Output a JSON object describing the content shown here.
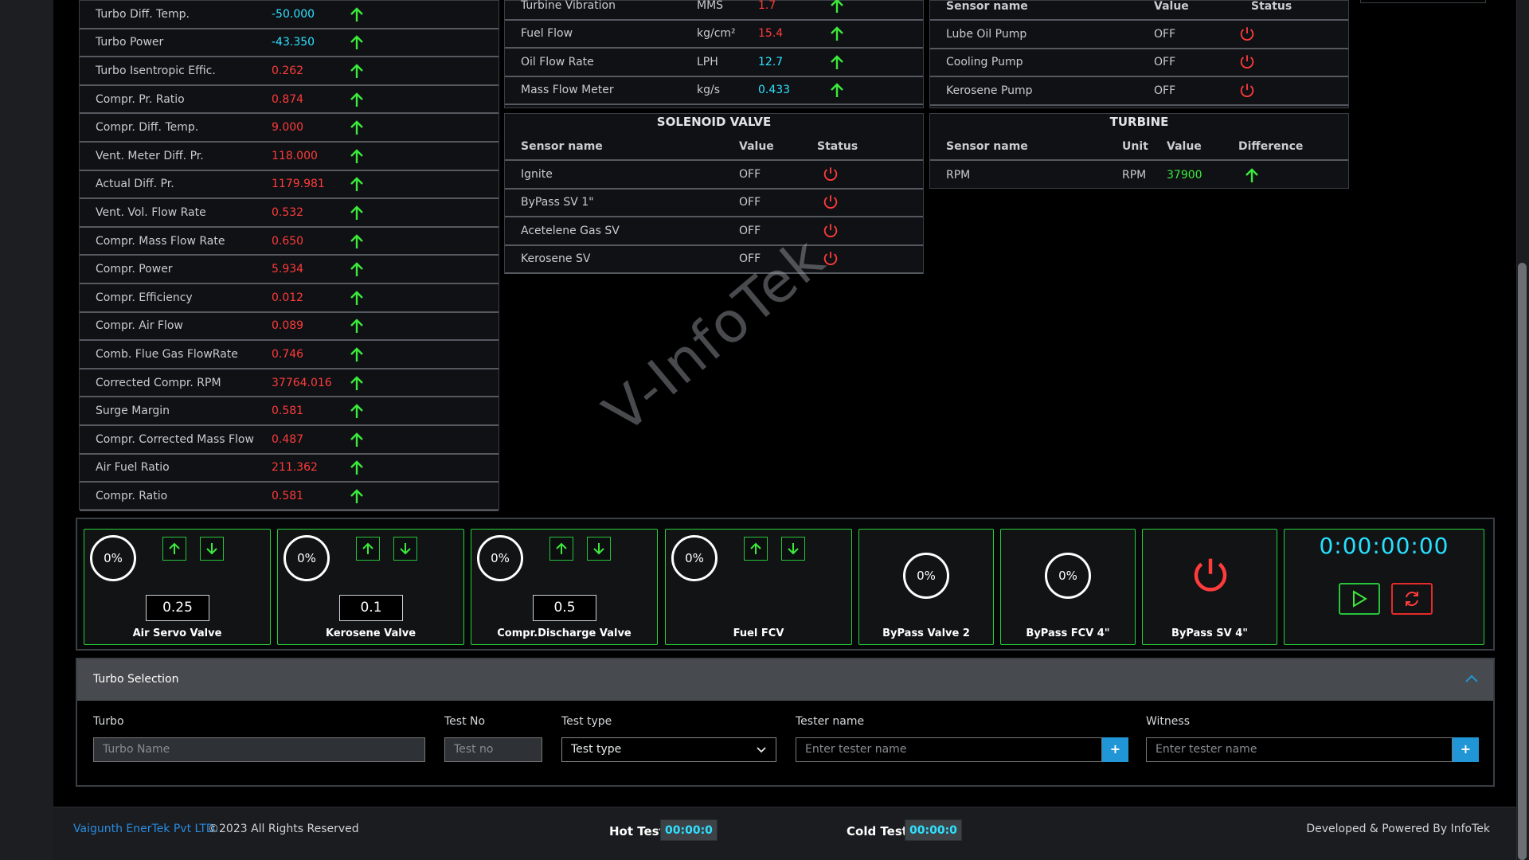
{
  "left_table": {
    "rows": [
      {
        "label": "Turbo Diff. Temp.",
        "value": "-50.000",
        "tone": "cyan"
      },
      {
        "label": "Turbo Power",
        "value": "-43.350",
        "tone": "cyan"
      },
      {
        "label": "Turbo Isentropic Effic.",
        "value": "0.262",
        "tone": "red"
      },
      {
        "label": "Compr. Pr. Ratio",
        "value": "0.874",
        "tone": "red"
      },
      {
        "label": "Compr. Diff. Temp.",
        "value": "9.000",
        "tone": "red"
      },
      {
        "label": "Vent. Meter Diff. Pr.",
        "value": "118.000",
        "tone": "red"
      },
      {
        "label": "Actual Diff. Pr.",
        "value": "1179.981",
        "tone": "red"
      },
      {
        "label": "Vent. Vol. Flow Rate",
        "value": "0.532",
        "tone": "red"
      },
      {
        "label": "Compr. Mass Flow Rate",
        "value": "0.650",
        "tone": "red"
      },
      {
        "label": "Compr. Power",
        "value": "5.934",
        "tone": "red"
      },
      {
        "label": "Compr. Efficiency",
        "value": "0.012",
        "tone": "red"
      },
      {
        "label": "Compr. Air Flow",
        "value": "0.089",
        "tone": "red"
      },
      {
        "label": "Comb. Flue Gas FlowRate",
        "value": "0.746",
        "tone": "red"
      },
      {
        "label": "Corrected Compr. RPM",
        "value": "37764.016",
        "tone": "red"
      },
      {
        "label": "Surge Margin",
        "value": "0.581",
        "tone": "red"
      },
      {
        "label": "Compr. Corrected Mass Flow",
        "value": "0.487",
        "tone": "red"
      },
      {
        "label": "Air Fuel Ratio",
        "value": "211.362",
        "tone": "red"
      },
      {
        "label": "Compr. Ratio",
        "value": "0.581",
        "tone": "red"
      }
    ]
  },
  "flow_table": {
    "rows": [
      {
        "label": "Turbine Vibration",
        "unit": "MMS",
        "value": "1.7",
        "tone": "red"
      },
      {
        "label": "Fuel Flow",
        "unit": "kg/cm²",
        "value": "15.4",
        "tone": "red"
      },
      {
        "label": "Oil Flow Rate",
        "unit": "LPH",
        "value": "12.7",
        "tone": "cyan"
      },
      {
        "label": "Mass Flow Meter",
        "unit": "kg/s",
        "value": "0.433",
        "tone": "cyan"
      }
    ]
  },
  "solenoid": {
    "title": "SOLENOID VALVE",
    "headers": {
      "name": "Sensor name",
      "value": "Value",
      "status": "Status"
    },
    "rows": [
      {
        "label": "Ignite",
        "value": "OFF"
      },
      {
        "label": "ByPass SV 1\"",
        "value": "OFF"
      },
      {
        "label": "Acetelene Gas SV",
        "value": "OFF"
      },
      {
        "label": "Kerosene SV",
        "value": "OFF"
      }
    ]
  },
  "pumps": {
    "headers": {
      "name": "Sensor name",
      "value": "Value",
      "status": "Status"
    },
    "rows": [
      {
        "label": "Lube Oil Pump",
        "value": "OFF"
      },
      {
        "label": "Cooling Pump",
        "value": "OFF"
      },
      {
        "label": "Kerosene Pump",
        "value": "OFF"
      }
    ]
  },
  "turbine": {
    "title": "TURBINE",
    "headers": {
      "name": "Sensor name",
      "unit": "Unit",
      "value": "Value",
      "diff": "Difference"
    },
    "rows": [
      {
        "label": "RPM",
        "unit": "RPM",
        "value": "37900"
      }
    ]
  },
  "controls": {
    "valves": [
      {
        "name": "Air Servo Valve",
        "percent": "0%",
        "setpoint": "0.25"
      },
      {
        "name": "Kerosene Valve",
        "percent": "0%",
        "setpoint": "0.1"
      },
      {
        "name": "Compr.Discharge Valve",
        "percent": "0%",
        "setpoint": "0.5"
      },
      {
        "name": "Fuel FCV",
        "percent": "0%"
      }
    ],
    "bypass": [
      {
        "name": "ByPass Valve 2",
        "percent": "0%"
      },
      {
        "name": "ByPass FCV 4\"",
        "percent": "0%"
      }
    ],
    "bypass_sv": {
      "name": "ByPass SV 4\""
    },
    "timer": "0:00:00:00"
  },
  "turbo_selection": {
    "title": "Turbo Selection",
    "fields": {
      "turbo": {
        "label": "Turbo",
        "placeholder": "Turbo Name"
      },
      "test_no": {
        "label": "Test No",
        "placeholder": "Test no"
      },
      "test_type": {
        "label": "Test type",
        "value": "Test type"
      },
      "tester": {
        "label": "Tester name",
        "placeholder": "Enter tester name"
      },
      "witness": {
        "label": "Witness",
        "placeholder": "Enter tester name"
      }
    },
    "plus": "+"
  },
  "footer": {
    "company": "Vaigunth EnerTek Pvt LTD.",
    "copyright": "©2023 All Rights Reserved",
    "hot_label": "Hot Test:",
    "hot_value": "00:00:0",
    "cold_label": "Cold Test:",
    "cold_value": "00:00:0",
    "credit": "Developed & Powered By InfoTek"
  },
  "watermark": "V-InfoTek",
  "colors": {
    "red": "#ff3b3b",
    "cyan": "#2fe1ff",
    "green": "#3bea3b",
    "accent": "#2196d6"
  }
}
